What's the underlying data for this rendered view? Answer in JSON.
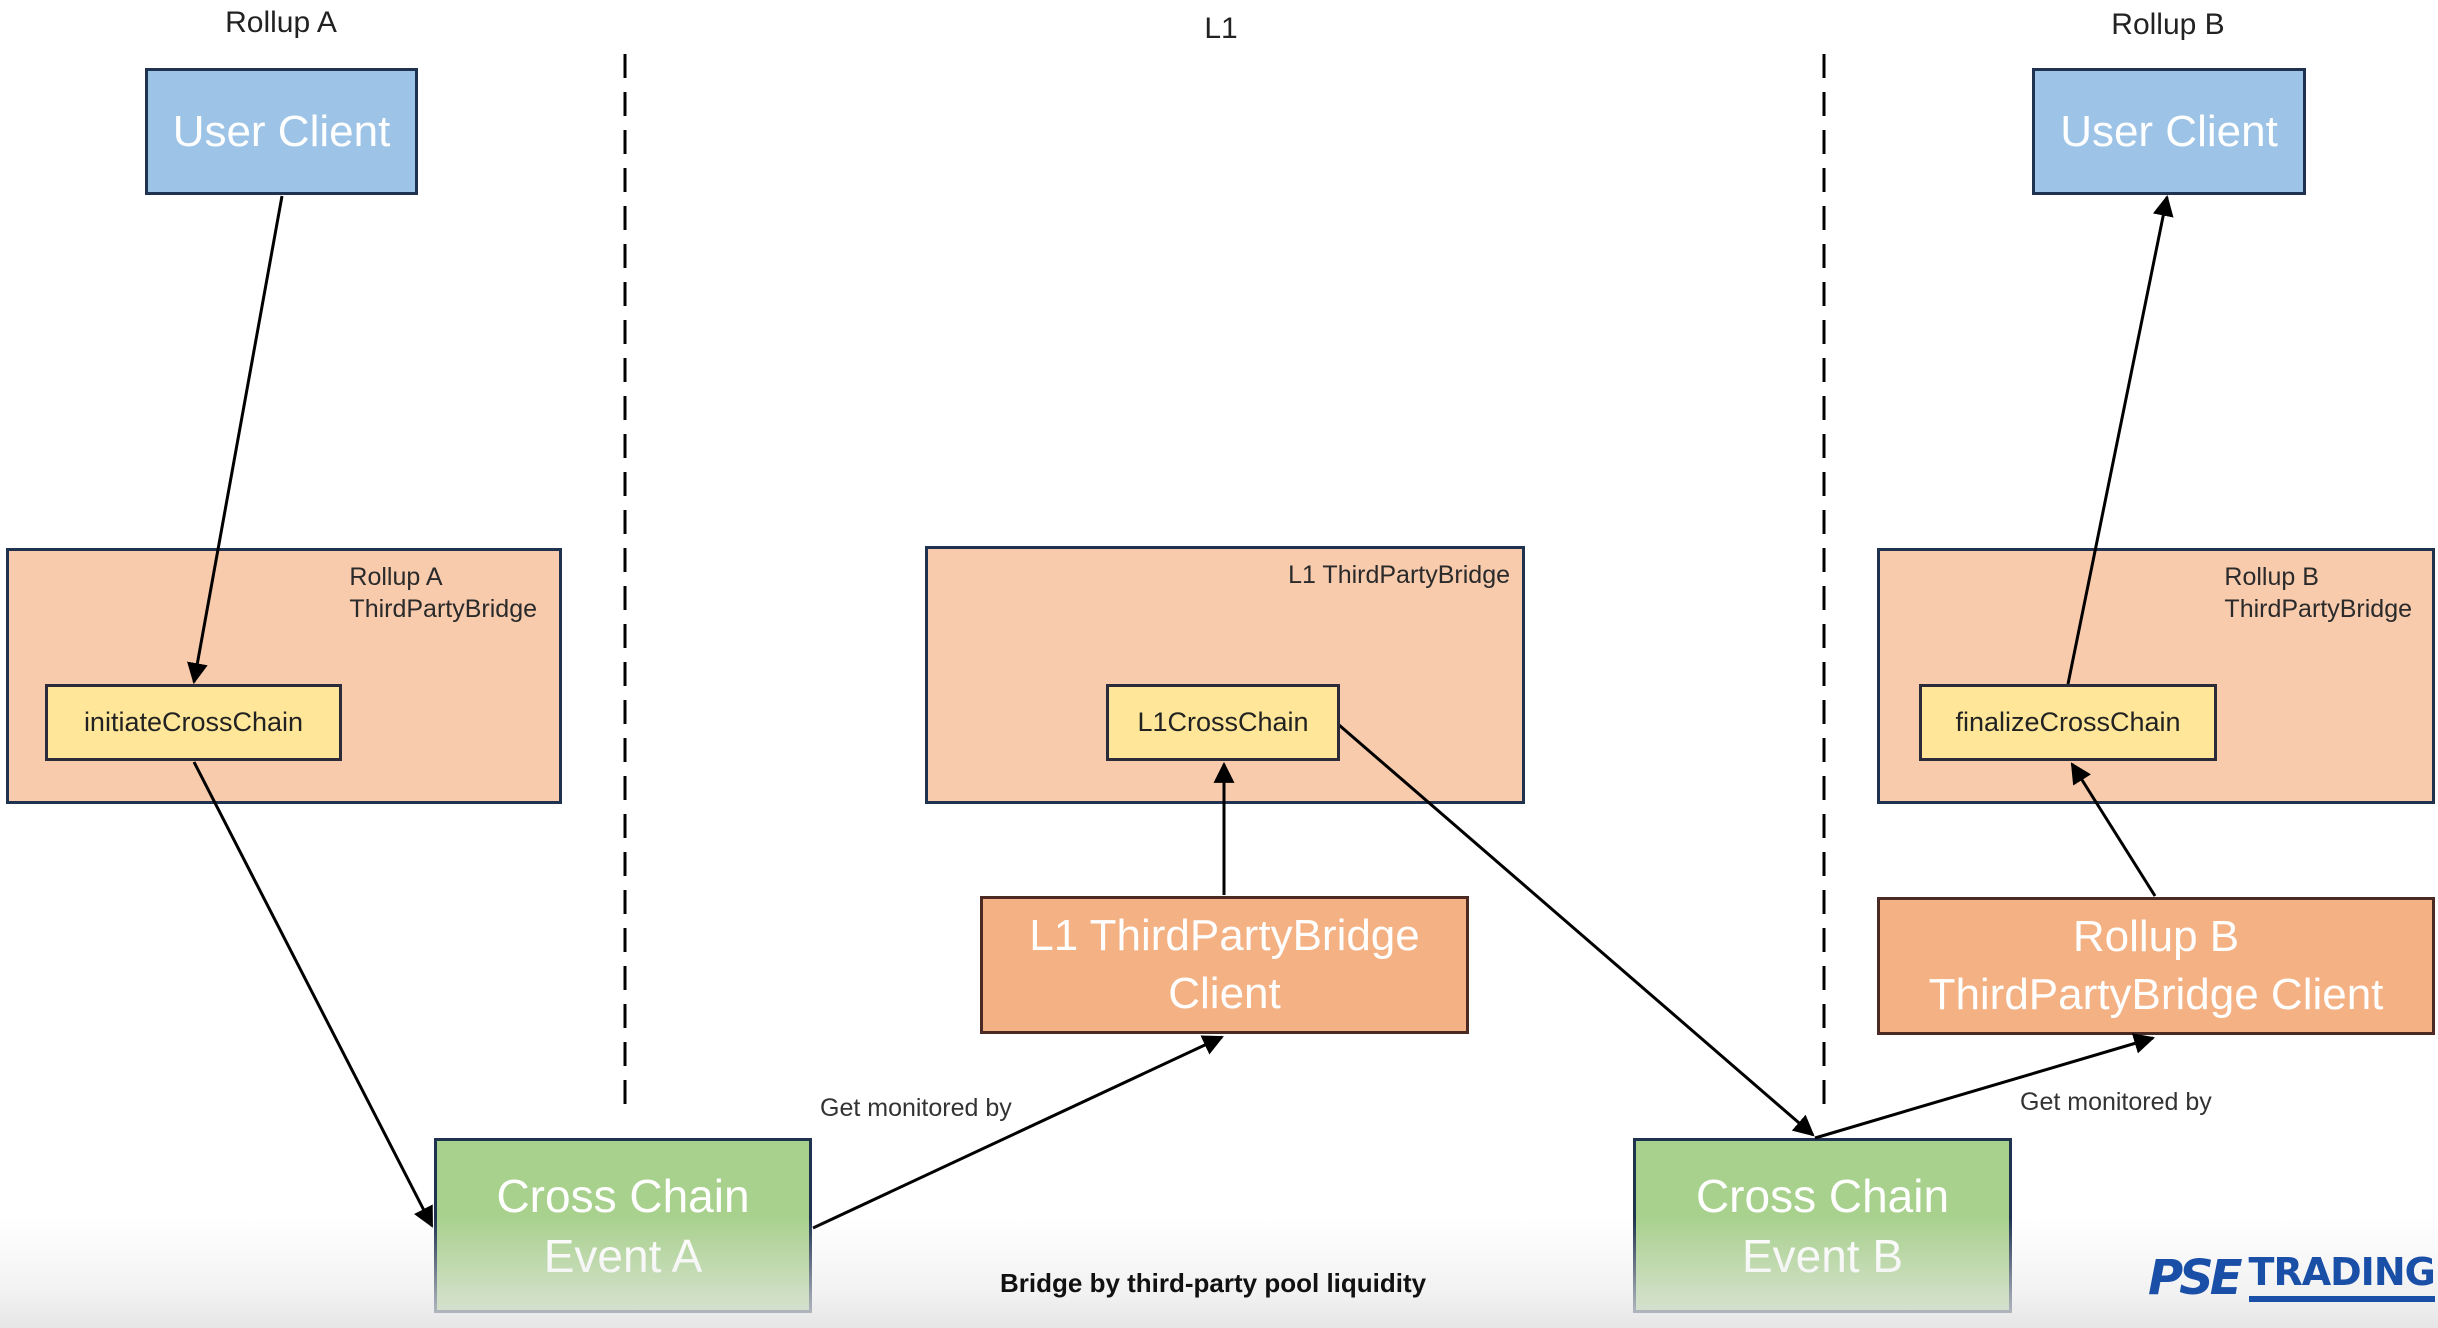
{
  "zones": {
    "left": "Rollup A",
    "middle": "L1",
    "right": "Rollup B"
  },
  "nodes": {
    "user_client_a": "User Client",
    "user_client_b": "User Client",
    "rollup_a_bridge_title": [
      "Rollup A",
      "ThirdPartyBridge"
    ],
    "l1_bridge_title": "L1 ThirdPartyBridge",
    "rollup_b_bridge_title": [
      "Rollup B",
      "ThirdPartyBridge"
    ],
    "initiate_fn": "initiateCrossChain",
    "l1_fn": "L1CrossChain",
    "finalize_fn": "finalizeCrossChain",
    "l1_client": [
      "L1 ThirdPartyBridge",
      "Client"
    ],
    "rollup_b_client": [
      "Rollup B",
      "ThirdPartyBridge Client"
    ],
    "event_a": [
      "Cross Chain",
      "Event A"
    ],
    "event_b": [
      "Cross Chain",
      "Event B"
    ]
  },
  "edges": [
    {
      "from": "User Client (Rollup A)",
      "to": "initiateCrossChain",
      "label": ""
    },
    {
      "from": "initiateCrossChain",
      "to": "Cross Chain Event A",
      "label": ""
    },
    {
      "from": "Cross Chain Event A",
      "to": "L1 ThirdPartyBridge Client",
      "label": "Get monitored by"
    },
    {
      "from": "L1 ThirdPartyBridge Client",
      "to": "L1CrossChain",
      "label": ""
    },
    {
      "from": "L1CrossChain",
      "to": "Cross Chain Event B",
      "label": ""
    },
    {
      "from": "Cross Chain Event B",
      "to": "Rollup B ThirdPartyBridge Client",
      "label": "Get monitored by"
    },
    {
      "from": "Rollup B ThirdPartyBridge Client",
      "to": "finalizeCrossChain",
      "label": ""
    },
    {
      "from": "finalizeCrossChain",
      "to": "User Client (Rollup B)",
      "label": ""
    }
  ],
  "edge_labels": {
    "monitored_a": "Get monitored by",
    "monitored_b": "Get monitored by"
  },
  "caption": "Bridge by third-party pool liquidity",
  "logo": {
    "mark": "PSE",
    "word": "TRADING",
    "color": "#1a4fa8"
  },
  "colors": {
    "user_client": "#9dc3e6",
    "bridge_container": "#f8cbad",
    "function_box": "#ffe699",
    "bridge_client": "#f4b183",
    "event": "#a9d18e"
  }
}
